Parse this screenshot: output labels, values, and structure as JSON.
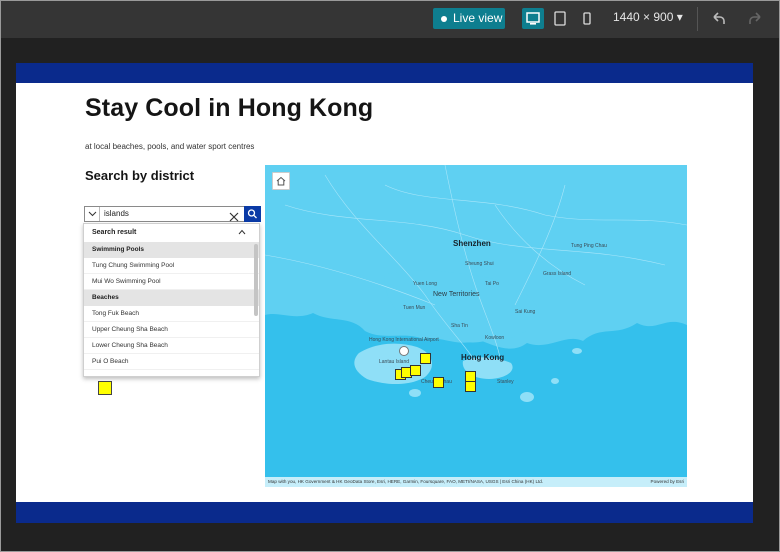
{
  "toolbar": {
    "live_view_label": "Live view",
    "screen_size": "1440 × 900",
    "devices": [
      "desktop",
      "tablet",
      "phone"
    ],
    "active_device": "desktop"
  },
  "page": {
    "title": "Stay Cool in Hong Kong",
    "subtitle": "at local beaches, pools, and water sport centres",
    "search_label": "Search by district",
    "search_value": "islands"
  },
  "results": {
    "header": "Search result",
    "groups": [
      {
        "name": "Swimming Pools",
        "items": [
          "Tung Chung Swimming Pool",
          "Mui Wo Swimming Pool"
        ]
      },
      {
        "name": "Beaches",
        "items": [
          "Tong Fuk Beach",
          "Upper Cheung Sha Beach",
          "Lower Cheung Sha Beach",
          "Pui O Beach"
        ]
      }
    ]
  },
  "map": {
    "labels": {
      "shenzhen": "Shenzhen",
      "new_territories": "New Territories",
      "hong_kong": "Hong Kong",
      "kowloon": "Kowloon",
      "lantau": "Lantau Island",
      "airport": "Hong Kong International Airport",
      "tai_po": "Tai Po",
      "sha_tin": "Sha Tin",
      "tuen_mun": "Tuen Mun",
      "yuen_long": "Yuen Long",
      "tsuen_wan": "Tsuen Wan",
      "sai_kung": "Sai Kung",
      "stanley": "Stanley",
      "cheung_chau": "Cheung Chau",
      "grass_island": "Grass Island",
      "tung_ping_chau": "Tung Ping Chau",
      "shenzhen_area": "Buji",
      "sheung_shui": "Sheung Shui"
    },
    "attribution": "Map with you, HK Government & HK GeoData Store, Esri, HERE, Garmin, Foursquare, FAO, METI/NASA, USGS | Esri China (HK) Ltd.",
    "powered_by": "Powered by Esri",
    "colors": {
      "water": "#34c0ec",
      "land": "#5fd0f2",
      "marker": "#ffff00"
    }
  },
  "colors": {
    "brand_band": "#0a2a8c",
    "accent": "#0e7e8f",
    "search_button": "#0a3aa6"
  }
}
